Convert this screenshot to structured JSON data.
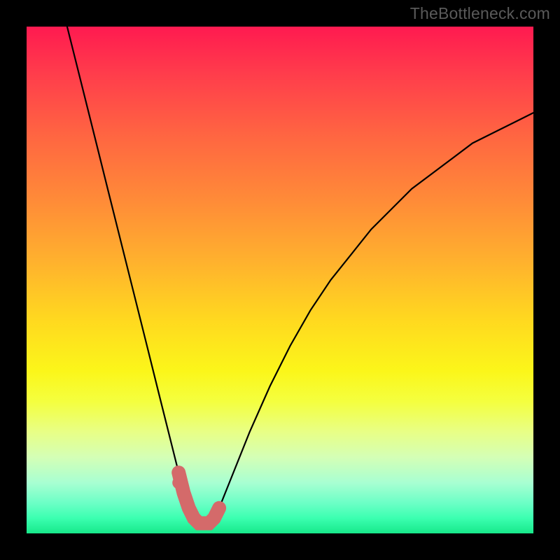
{
  "watermark": "TheBottleneck.com",
  "chart_data": {
    "type": "line",
    "title": "",
    "xlabel": "",
    "ylabel": "",
    "xlim": [
      0,
      100
    ],
    "ylim": [
      0,
      100
    ],
    "series": [
      {
        "name": "bottleneck-curve",
        "x": [
          8,
          10,
          12,
          14,
          16,
          18,
          20,
          22,
          24,
          26,
          28,
          30,
          31,
          32,
          33,
          34,
          35,
          36,
          37,
          38,
          40,
          44,
          48,
          52,
          56,
          60,
          64,
          68,
          72,
          76,
          80,
          84,
          88,
          92,
          96,
          100
        ],
        "y": [
          100,
          92,
          84,
          76,
          68,
          60,
          52,
          44,
          36,
          28,
          20,
          12,
          8,
          5,
          3,
          2,
          2,
          2,
          3,
          5,
          10,
          20,
          29,
          37,
          44,
          50,
          55,
          60,
          64,
          68,
          71,
          74,
          77,
          79,
          81,
          83
        ]
      }
    ],
    "highlight": {
      "name": "bottom-segment",
      "color": "#d46a6a",
      "x": [
        30,
        31,
        32,
        33,
        34,
        35,
        36,
        37,
        38
      ],
      "y": [
        12,
        8,
        5,
        3,
        2,
        2,
        2,
        3,
        5
      ]
    },
    "highlight_dot": {
      "x": 30,
      "y": 10
    },
    "gradient_stops": [
      {
        "pos": 0.0,
        "color": "#ff1a50"
      },
      {
        "pos": 0.5,
        "color": "#ffd91f"
      },
      {
        "pos": 0.8,
        "color": "#f4ff3f"
      },
      {
        "pos": 1.0,
        "color": "#17e88a"
      }
    ]
  }
}
